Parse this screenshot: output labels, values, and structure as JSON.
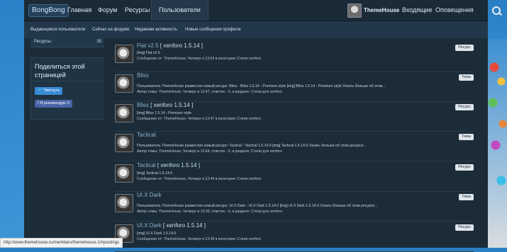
{
  "nav": {
    "logo": "BongBong",
    "items": [
      "Главная",
      "Форум",
      "Ресурсы",
      "Пользователи"
    ],
    "user": "ThemeHouse",
    "inbox": "Входящие",
    "alerts": "Оповещения"
  },
  "subnav": [
    "Выдающиеся пользователи",
    "Сейчас на форуме",
    "Недавняя активность",
    "Новые сообщения профиля"
  ],
  "sidebar": {
    "resources_label": "Ресурсы:",
    "resources_count": "35",
    "share_title": "Поделиться этой страницей",
    "tweet_label": "Твитнуть",
    "recommend_label": "Я рекомендую",
    "recommend_count": "0"
  },
  "results": [
    {
      "title_main": "Flat v2.5",
      "title_suffix": "[ xenforo 1.5.14 ]",
      "snippet": "[img] Flat v2.5",
      "meta": "Сообщение от: ThemeHouse, Четверг в 13:54 в категории: Стили xenforo",
      "badge": "Ресурс"
    },
    {
      "title_main": "Bliss",
      "title_suffix": "",
      "snippet": "Пользователь ThemeHouse разместил новый ресурс: Bliss - Bliss 1.5.14 - Premium style [img] Bliss 1.5.14 - Premium style Узнать больше об этом...",
      "meta": "Автор темы: ThemeHouse, Четверг в 13:47, ответов - 0, в разделе: Стили для xenforo",
      "badge": "Тема"
    },
    {
      "title_main": "Bliss",
      "title_suffix": "[ xenforo 1.5.14 ]",
      "snippet": "[img] Bliss 1.5.14 - Premium style",
      "meta": "Сообщение от: ThemeHouse, Четверг в 13:47 в категории: Стили xenforo",
      "badge": "Ресурс"
    },
    {
      "title_main": "Tactical",
      "title_suffix": "",
      "snippet": "Пользователь ThemeHouse разместил новый ресурс: Tactical - Tactical 1.5.14.0 [img] Tactical 1.5.14.0 Узнать больше об этом ресурсе...",
      "meta": "Автор темы: ThemeHouse, Четверг в 13:44, ответов - 0, в разделе: Стили для xenforo",
      "badge": "Тема"
    },
    {
      "title_main": "Tactical",
      "title_suffix": "[ xenforo 1.5.14 ]",
      "snippet": "[img] Tactical 1.5.14.0",
      "meta": "Сообщение от: ThemeHouse, Четверг в 13:44 в категории: Стили xenforo",
      "badge": "Ресурс"
    },
    {
      "title_main": "UI.X Dark",
      "title_suffix": "",
      "snippet": "Пользователь ThemeHouse разместил новый ресурс: UI.X Dark - UI.X Dark 1.5.14.0 [img] UI.X Dark 1.5.14.0 Узнать больше об этом ресурсе...",
      "meta": "Автор темы: ThemeHouse, Четверг в 13:39, ответов - 0, в разделе: Стили для xenforo",
      "badge": "Тема"
    },
    {
      "title_main": "UI.X Dark",
      "title_suffix": "[ xenforo 1.5.14 ]",
      "snippet": "[img] UI.X Dark 1.5.14.0",
      "meta": "Сообщение от: ThemeHouse, Четверг в 13:39 в категории: Стили xenforo",
      "badge": "Ресурс"
    }
  ],
  "status_url": "http://www.themehouse.ru/members/themehouse.1/#postings"
}
